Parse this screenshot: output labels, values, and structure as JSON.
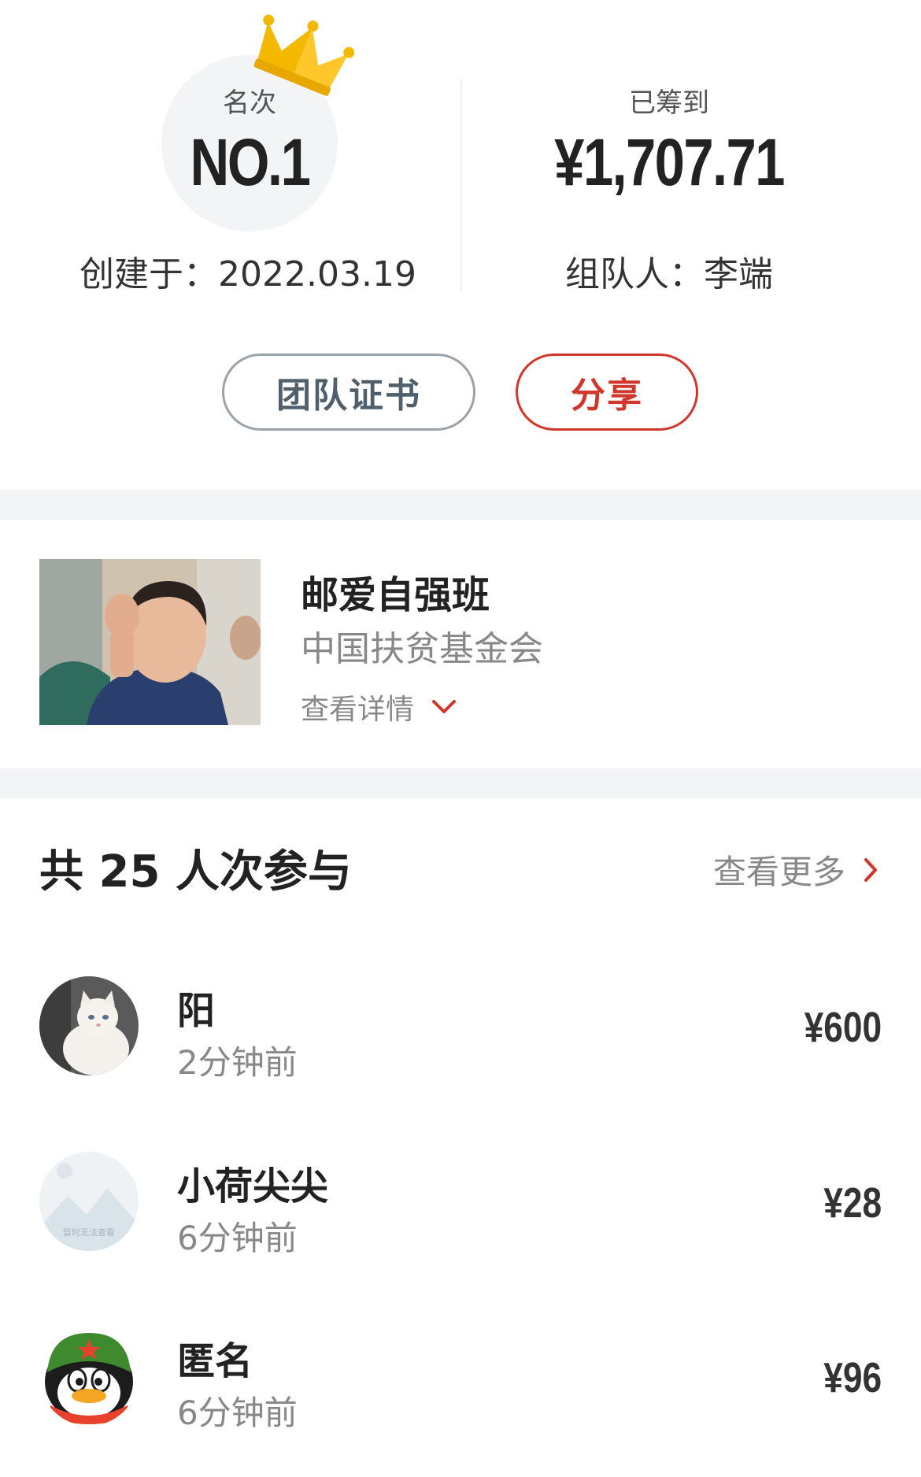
{
  "stats": {
    "rank_label": "名次",
    "rank_value": "NO.1",
    "created_text": "创建于：2022.03.19",
    "raised_label": "已筹到",
    "raised_value": "¥1,707.71",
    "leader_text": "组队人：李端"
  },
  "buttons": {
    "certificate": "团队证书",
    "share": "分享"
  },
  "project": {
    "title": "邮爱自强班",
    "org": "中国扶贫基金会",
    "detail_label": "查看详情"
  },
  "participants": {
    "header": "共 25 人次参与",
    "more_label": "查看更多",
    "list": [
      {
        "name": "阳",
        "time": "2分钟前",
        "amount": "¥600"
      },
      {
        "name": "小荷尖尖",
        "time": "6分钟前",
        "amount": "¥28",
        "avatar_caption": "暂时无法查看"
      },
      {
        "name": "匿名",
        "time": "6分钟前",
        "amount": "¥96"
      }
    ]
  },
  "colors": {
    "accent_red": "#d1362b",
    "crown_gold": "#f5b800",
    "separator": "#f3f4f6"
  }
}
